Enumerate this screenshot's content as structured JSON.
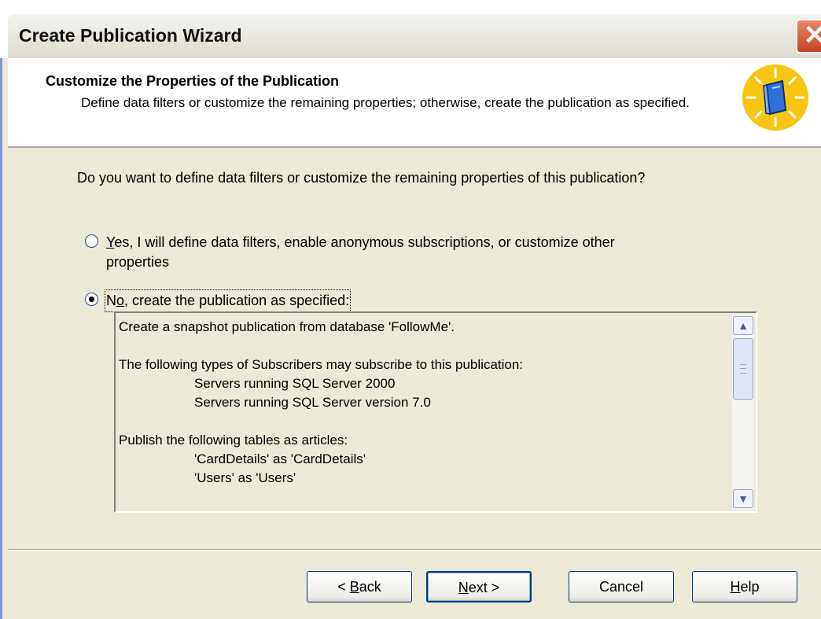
{
  "window": {
    "title": "Create Publication Wizard",
    "close_glyph": "✕"
  },
  "header": {
    "title": "Customize the Properties of the Publication",
    "description": "Define data filters or customize the remaining properties; otherwise, create the publication as specified.",
    "icon": "wizard-book-icon"
  },
  "main": {
    "question": "Do you want to define data filters or customize the remaining properties of this publication?",
    "options": [
      {
        "mnemonic": "Y",
        "label_rest": "es, I will define data filters, enable anonymous subscriptions, or customize other",
        "label_line2": "properties",
        "selected": false
      },
      {
        "mnemonic": "o",
        "label_prefix": "N",
        "label_rest": ", create the publication as specified:",
        "selected": true
      }
    ],
    "summary_lines": [
      "Create a snapshot publication from database 'FollowMe'.",
      "",
      "The following types of Subscribers may subscribe to this publication:",
      "Servers running SQL Server 2000",
      "Servers running SQL Server version 7.0",
      "",
      "Publish the following tables as articles:",
      "'CardDetails' as 'CardDetails'",
      "'Users' as 'Users'"
    ]
  },
  "buttons": {
    "back_prefix": "< ",
    "back_mnemonic": "B",
    "back_rest": "ack",
    "next_mnemonic": "N",
    "next_rest": "ext >",
    "cancel": "Cancel",
    "help_mnemonic": "H",
    "help_rest": "elp"
  },
  "colors": {
    "dialog_face": "#ece9d8",
    "title_bar": "#dedbce",
    "close_button": "#c64320",
    "icon_yellow": "#f7c512"
  }
}
